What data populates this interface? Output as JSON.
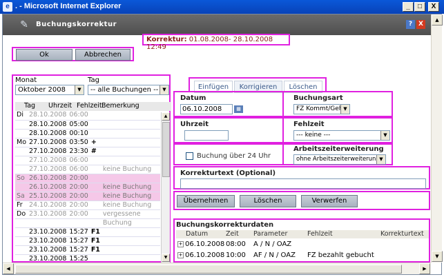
{
  "window": {
    "title": ". - Microsoft Internet Explorer",
    "minimize": "_",
    "maximize": "□",
    "close": "X"
  },
  "dialog": {
    "title": "Buchungskorrektur",
    "help": "?",
    "close": "X"
  },
  "korrektur": {
    "label": "Korrektur:",
    "range": "01.08.2008- 28.10.2008 12:49"
  },
  "actions": {
    "ok": "Ok",
    "cancel": "Abbrechen"
  },
  "filters": {
    "monat_label": "Monat",
    "tag_label": "Tag",
    "monat_value": "Oktober 2008",
    "tag_value": "-- alle Buchungen --"
  },
  "list": {
    "headers": [
      "Tag",
      "Uhrzeit",
      "Fehlzeit",
      "Bemerkung"
    ],
    "rows": [
      {
        "wd": "Di",
        "date": "28.10.2008",
        "time": "06:00",
        "mark": "",
        "rem": "",
        "style": "grey"
      },
      {
        "wd": "",
        "date": "28.10.2008",
        "time": "05:00",
        "mark": "",
        "rem": "",
        "style": ""
      },
      {
        "wd": "",
        "date": "28.10.2008",
        "time": "00:10",
        "mark": "",
        "rem": "",
        "style": ""
      },
      {
        "wd": "Mo",
        "date": "27.10.2008",
        "time": "03:50",
        "mark": "+",
        "rem": "",
        "style": ""
      },
      {
        "wd": "",
        "date": "27.10.2008",
        "time": "23:30",
        "mark": "#",
        "rem": "",
        "style": ""
      },
      {
        "wd": "",
        "date": "27.10.2008",
        "time": "06:00",
        "mark": "",
        "rem": "",
        "style": "grey"
      },
      {
        "wd": "",
        "date": "27.10.2008",
        "time": "06:00",
        "mark": "",
        "rem": "keine Buchung",
        "style": "grey"
      },
      {
        "wd": "So",
        "date": "26.10.2008",
        "time": "20:00",
        "mark": "",
        "rem": "",
        "style": "pk"
      },
      {
        "wd": "",
        "date": "26.10.2008",
        "time": "20:00",
        "mark": "",
        "rem": "keine Buchung",
        "style": "pk"
      },
      {
        "wd": "Sa",
        "date": "25.10.2008",
        "time": "20:00",
        "mark": "",
        "rem": "keine Buchung",
        "style": "pk"
      },
      {
        "wd": "Fr",
        "date": "24.10.2008",
        "time": "20:00",
        "mark": "",
        "rem": "keine Buchung",
        "style": "grey"
      },
      {
        "wd": "Do",
        "date": "23.10.2008",
        "time": "20:00",
        "mark": "",
        "rem": "vergessene",
        "style": "grey"
      },
      {
        "wd": "",
        "date": "",
        "time": "",
        "mark": "",
        "rem": "Buchung",
        "style": "grey"
      },
      {
        "wd": "",
        "date": "23.10.2008",
        "time": "15:27",
        "mark": "F1",
        "rem": "",
        "style": ""
      },
      {
        "wd": "",
        "date": "23.10.2008",
        "time": "15:27",
        "mark": "F1",
        "rem": "",
        "style": ""
      },
      {
        "wd": "",
        "date": "23.10.2008",
        "time": "15:27",
        "mark": "F1",
        "rem": "",
        "style": ""
      },
      {
        "wd": "",
        "date": "23.10.2008",
        "time": "15:25",
        "mark": "",
        "rem": "",
        "style": ""
      }
    ]
  },
  "tabs": [
    "Einfügen",
    "Korrigieren",
    "Löschen"
  ],
  "form": {
    "datum_label": "Datum",
    "datum_value": "06.10.2008",
    "buchungsart_label": "Buchungsart",
    "buchungsart_value": "FZ Kommt/Geht",
    "uhrzeit_label": "Uhrzeit",
    "uhrzeit_value": "",
    "fehlzeit_label": "Fehlzeit",
    "fehlzeit_value": "--- keine ---",
    "check_label": "Buchung über 24 Uhr",
    "azw_label": "Arbeitszeiterweiterung",
    "azw_value": "ohne Arbeitszeiterweiterung",
    "korrekturtext_label": "Korrekturtext (Optional)",
    "korrekturtext_value": "",
    "btn_apply": "Übernehmen",
    "btn_delete": "Löschen",
    "btn_discard": "Verwerfen"
  },
  "daten": {
    "title": "Buchungskorrekturdaten",
    "headers": [
      "Datum",
      "Zeit",
      "Parameter",
      "Fehlzeit",
      "Korrekturtext"
    ],
    "rows": [
      {
        "date": "06.10.2008",
        "time": "08:00",
        "param": "A / N / OAZ",
        "fehl": "",
        "text": ""
      },
      {
        "date": "06.10.2008",
        "time": "10:00",
        "param": "AF / N / OAZ",
        "fehl": "FZ bezahlt gebucht",
        "text": ""
      }
    ]
  },
  "colors": {
    "highlight": "#e020e0",
    "titlebar": "#0842b8",
    "pink_row": "#f5c8e8"
  }
}
